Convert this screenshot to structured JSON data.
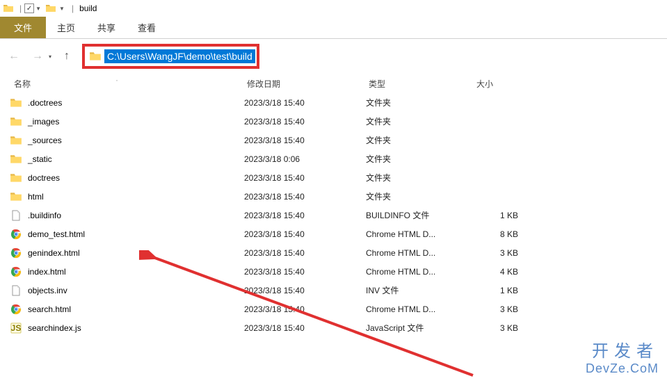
{
  "window": {
    "title": "build"
  },
  "ribbon": {
    "file": "文件",
    "home": "主页",
    "share": "共享",
    "view": "查看"
  },
  "address": {
    "path": "C:\\Users\\WangJF\\demo\\test\\build"
  },
  "columns": {
    "name": "名称",
    "date": "修改日期",
    "type": "类型",
    "size": "大小"
  },
  "files": [
    {
      "icon": "folder",
      "name": ".doctrees",
      "date": "2023/3/18 15:40",
      "type": "文件夹",
      "size": ""
    },
    {
      "icon": "folder",
      "name": "_images",
      "date": "2023/3/18 15:40",
      "type": "文件夹",
      "size": ""
    },
    {
      "icon": "folder",
      "name": "_sources",
      "date": "2023/3/18 15:40",
      "type": "文件夹",
      "size": ""
    },
    {
      "icon": "folder",
      "name": "_static",
      "date": "2023/3/18 0:06",
      "type": "文件夹",
      "size": ""
    },
    {
      "icon": "folder",
      "name": "doctrees",
      "date": "2023/3/18 15:40",
      "type": "文件夹",
      "size": ""
    },
    {
      "icon": "folder",
      "name": "html",
      "date": "2023/3/18 15:40",
      "type": "文件夹",
      "size": ""
    },
    {
      "icon": "file",
      "name": ".buildinfo",
      "date": "2023/3/18 15:40",
      "type": "BUILDINFO 文件",
      "size": "1 KB"
    },
    {
      "icon": "chrome",
      "name": "demo_test.html",
      "date": "2023/3/18 15:40",
      "type": "Chrome HTML D...",
      "size": "8 KB"
    },
    {
      "icon": "chrome",
      "name": "genindex.html",
      "date": "2023/3/18 15:40",
      "type": "Chrome HTML D...",
      "size": "3 KB"
    },
    {
      "icon": "chrome",
      "name": "index.html",
      "date": "2023/3/18 15:40",
      "type": "Chrome HTML D...",
      "size": "4 KB"
    },
    {
      "icon": "file",
      "name": "objects.inv",
      "date": "2023/3/18 15:40",
      "type": "INV 文件",
      "size": "1 KB"
    },
    {
      "icon": "chrome",
      "name": "search.html",
      "date": "2023/3/18 15:40",
      "type": "Chrome HTML D...",
      "size": "3 KB"
    },
    {
      "icon": "js",
      "name": "searchindex.js",
      "date": "2023/3/18 15:40",
      "type": "JavaScript 文件",
      "size": "3 KB"
    }
  ],
  "watermark": {
    "top": "开发者",
    "bottom": "DevZe.CoM"
  }
}
